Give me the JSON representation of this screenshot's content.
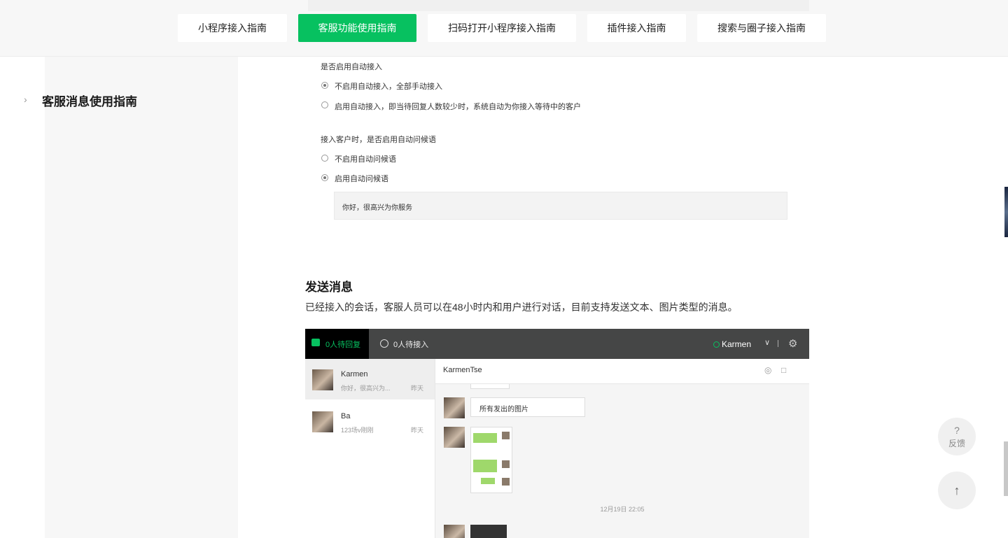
{
  "nav": {
    "tabs": [
      {
        "label": "小程序接入指南",
        "active": false
      },
      {
        "label": "客服功能使用指南",
        "active": true
      },
      {
        "label": "扫码打开小程序接入指南",
        "active": false
      },
      {
        "label": "插件接入指南",
        "active": false
      },
      {
        "label": "搜索与圈子接入指南",
        "active": false
      }
    ]
  },
  "sidebar": {
    "items": [
      {
        "label": "客服消息使用指南",
        "icon": "chevron-right-icon"
      }
    ]
  },
  "settings": {
    "auto_accept_title": "是否启用自动接入",
    "auto_accept_options": [
      {
        "label": "不启用自动接入，全部手动接入",
        "selected": true
      },
      {
        "label": "启用自动接入，即当待回复人数较少时，系统自动为你接入等待中的客户",
        "selected": false
      }
    ],
    "greeting_title": "接入客户时，是否启用自动问候语",
    "greeting_options": [
      {
        "label": "不启用自动问候语",
        "selected": false
      },
      {
        "label": "启用自动问候语",
        "selected": true
      }
    ],
    "greeting_text": "你好，很高兴为你服务"
  },
  "section": {
    "heading": "发送消息",
    "description": "已经接入的会话，客服人员可以在48小时内和用户进行对话，目前支持发送文本、图片类型的消息。"
  },
  "console": {
    "tab_pending_reply": "0人待回复",
    "tab_waiting": "0人待接入",
    "user_name": "Karmen",
    "conversations": [
      {
        "name": "Karmen",
        "preview": "你好，很高兴为...",
        "time": "昨天"
      },
      {
        "name": "Ba",
        "preview": "123场v刚刚",
        "time": "昨天"
      }
    ],
    "chat_title": "KarmenTse",
    "message_text": "所有发出的图片",
    "timestamp": "12月19日 22:05",
    "accent_color": "#07c160"
  },
  "widgets": {
    "feedback_icon": "?",
    "feedback_label": "反馈",
    "back_to_top_icon": "arrow-up-icon"
  }
}
